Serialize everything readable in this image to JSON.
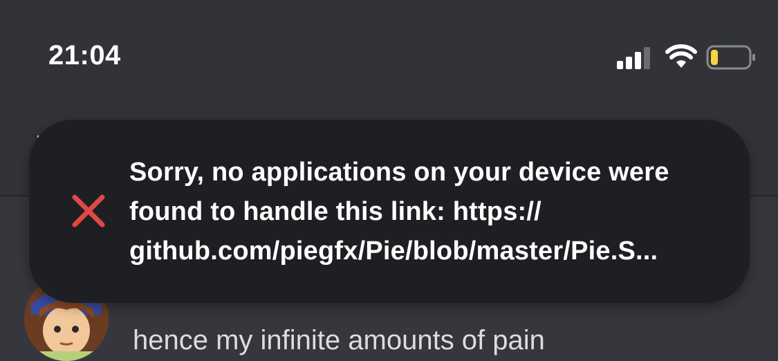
{
  "status_bar": {
    "time": "21:04",
    "signal_icon": "cellular-signal-icon",
    "wifi_icon": "wifi-icon",
    "battery_icon": "battery-low-icon",
    "battery_level": 0.15,
    "battery_color": "#f5d442"
  },
  "toast": {
    "icon": "error-x-icon",
    "icon_color": "#e04848",
    "lines": [
      "Sorry, no applications on your device were",
      "found to handle this link: https://",
      "github.com/piegfx/Pie/blob/master/Pie.S..."
    ]
  },
  "message": {
    "text": "hence my infinite amounts of pain",
    "avatar": "user-avatar"
  }
}
